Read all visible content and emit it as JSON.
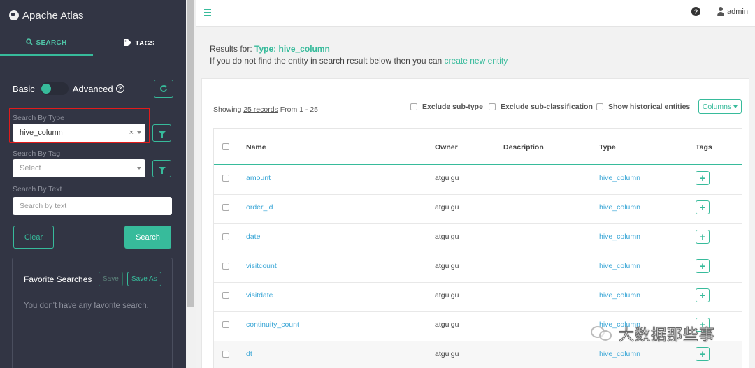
{
  "app": {
    "title": "Apache Atlas"
  },
  "sidebar": {
    "tabs": [
      {
        "label": "SEARCH",
        "icon": "search-icon",
        "active": true
      },
      {
        "label": "TAGS",
        "icon": "tag-icon",
        "active": false
      }
    ],
    "mode": {
      "basic_label": "Basic",
      "advanced_label": "Advanced",
      "help": "?"
    },
    "search_by_type": {
      "label": "Search By Type",
      "value": "hive_column",
      "clear": "×"
    },
    "search_by_tag": {
      "label": "Search By Tag",
      "placeholder": "Select"
    },
    "search_by_text": {
      "label": "Search By Text",
      "placeholder": "Search by text"
    },
    "clear_label": "Clear",
    "search_label": "Search",
    "favorites": {
      "title": "Favorite Searches",
      "save_label": "Save",
      "save_as_label": "Save As",
      "empty_text": "You don't have any favorite search."
    }
  },
  "topbar": {
    "help": "?",
    "username": "admin"
  },
  "results": {
    "prefix": "Results for:",
    "type_label": "Type:",
    "type_value": "hive_column",
    "hint_text": "If you do not find the entity in search result below then you can",
    "hint_link": "create new entity",
    "showing_prefix": "Showing",
    "showing_records": "25 records",
    "showing_range": "From 1 - 25",
    "options": [
      "Exclude sub-type",
      "Exclude sub-classification",
      "Show historical entities"
    ],
    "columns_label": "Columns"
  },
  "table": {
    "headers": {
      "name": "Name",
      "owner": "Owner",
      "description": "Description",
      "type": "Type",
      "tags": "Tags"
    },
    "rows": [
      {
        "name": "amount",
        "owner": "atguigu",
        "description": "",
        "type": "hive_column"
      },
      {
        "name": "order_id",
        "owner": "atguigu",
        "description": "",
        "type": "hive_column"
      },
      {
        "name": "date",
        "owner": "atguigu",
        "description": "",
        "type": "hive_column"
      },
      {
        "name": "visitcount",
        "owner": "atguigu",
        "description": "",
        "type": "hive_column"
      },
      {
        "name": "visitdate",
        "owner": "atguigu",
        "description": "",
        "type": "hive_column"
      },
      {
        "name": "continuity_count",
        "owner": "atguigu",
        "description": "",
        "type": "hive_column"
      },
      {
        "name": "dt",
        "owner": "atguigu",
        "description": "",
        "type": "hive_column"
      }
    ],
    "add_tag": "+"
  },
  "watermark": {
    "text": "大数据那些事"
  },
  "colors": {
    "accent": "#37bb9b",
    "sidebar_bg": "#323544",
    "link": "#3aa6d6",
    "highlight": "#e21b1b"
  }
}
